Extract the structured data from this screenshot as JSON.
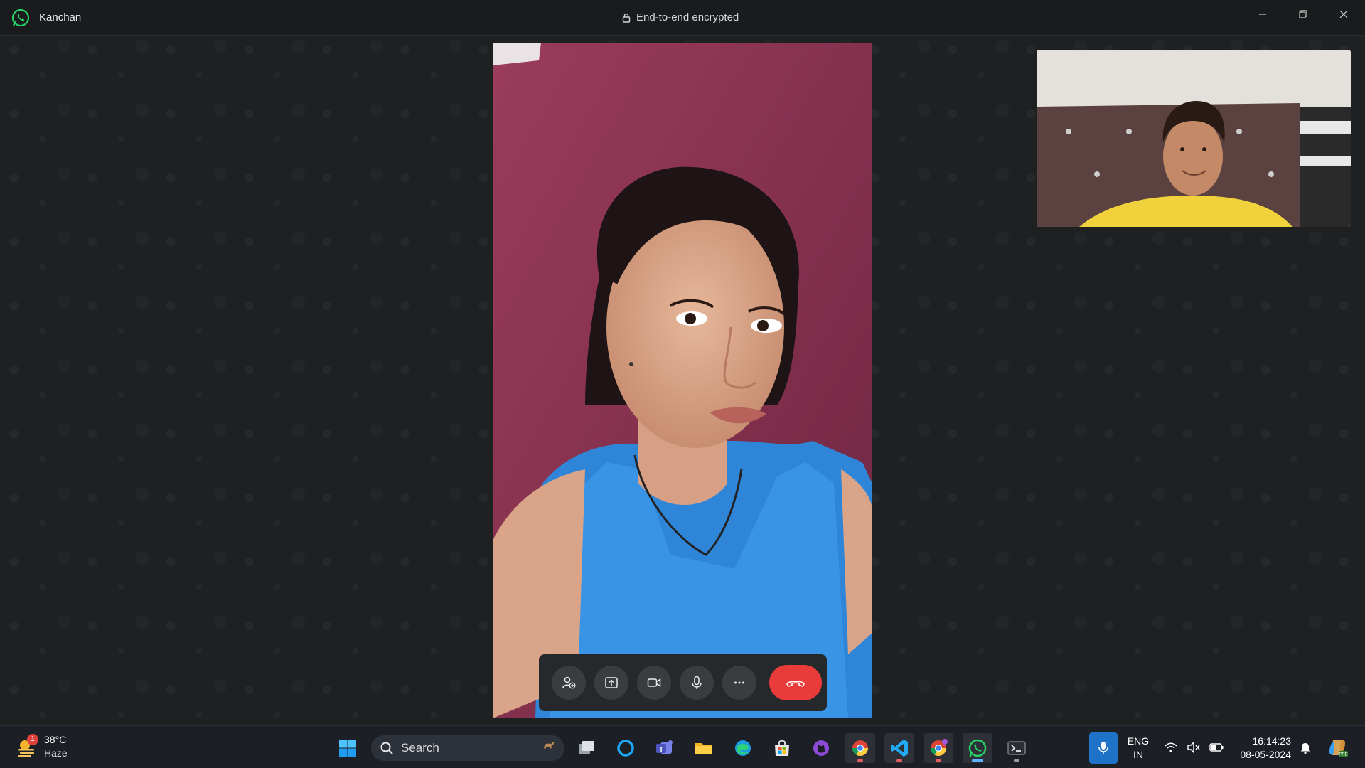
{
  "titlebar": {
    "contact_name": "Kanchan",
    "encryption_label": "End-to-end encrypted"
  },
  "colors": {
    "accent_green": "#25d366",
    "end_call_red": "#ea3b3b",
    "background": "#1f2022",
    "control_bar": "#26292b"
  },
  "call_controls": [
    {
      "name": "add-participant",
      "icon": "add-person-icon"
    },
    {
      "name": "share-screen",
      "icon": "share-screen-icon"
    },
    {
      "name": "camera",
      "icon": "video-camera-icon"
    },
    {
      "name": "microphone",
      "icon": "microphone-icon"
    },
    {
      "name": "more-options",
      "icon": "more-dots-icon"
    },
    {
      "name": "end-call",
      "icon": "phone-hangup-icon"
    }
  ],
  "taskbar": {
    "weather": {
      "temperature": "38°C",
      "condition": "Haze",
      "badge": "1"
    },
    "search_label": "Search",
    "apps": [
      "windows-start",
      "search",
      "task-view",
      "cortana",
      "teams",
      "file-explorer",
      "edge",
      "microsoft-store",
      "github-desktop",
      "chrome-profile-1",
      "vscode",
      "chrome-profile-2",
      "whatsapp",
      "terminal"
    ],
    "language": {
      "line1": "ENG",
      "line2": "IN"
    },
    "clock": {
      "time": "16:14:23",
      "date": "08-05-2024"
    }
  }
}
